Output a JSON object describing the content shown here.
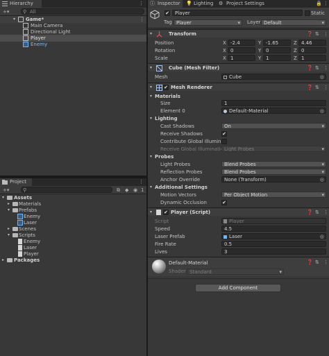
{
  "hierarchy": {
    "tab_label": "Hierarchy",
    "search_placeholder": "All",
    "items": [
      {
        "label": "Game*"
      },
      {
        "label": "Main Camera"
      },
      {
        "label": "Directional Light"
      },
      {
        "label": "Player"
      },
      {
        "label": "Enemy"
      }
    ]
  },
  "project": {
    "tab_label": "Project",
    "badge_count": "1",
    "tree": [
      {
        "label": "Assets"
      },
      {
        "label": "Materials"
      },
      {
        "label": "Prefabs"
      },
      {
        "label": "Enemy"
      },
      {
        "label": "Laser"
      },
      {
        "label": "Scenes"
      },
      {
        "label": "Scripts"
      },
      {
        "label": "Enemy"
      },
      {
        "label": "Laser"
      },
      {
        "label": "Player"
      },
      {
        "label": "Packages"
      }
    ]
  },
  "inspector": {
    "tabs": [
      {
        "label": "Inspector"
      },
      {
        "label": "Lighting"
      },
      {
        "label": "Project Settings"
      }
    ],
    "object": {
      "name": "Player",
      "static_label": "Static",
      "tag_label": "Tag",
      "tag_value": "Player",
      "layer_label": "Layer",
      "layer_value": "Default"
    },
    "transform": {
      "title": "Transform",
      "rows": [
        {
          "label": "Position",
          "x": "-2.4",
          "y": "-1.65",
          "z": "4.46"
        },
        {
          "label": "Rotation",
          "x": "0",
          "y": "0",
          "z": "0"
        },
        {
          "label": "Scale",
          "x": "1",
          "y": "1",
          "z": "1"
        }
      ],
      "axis_x": "X",
      "axis_y": "Y",
      "axis_z": "Z"
    },
    "mesh_filter": {
      "title": "Cube (Mesh Filter)",
      "mesh_label": "Mesh",
      "mesh_value": "Cube"
    },
    "mesh_renderer": {
      "title": "Mesh Renderer",
      "materials_label": "Materials",
      "size_label": "Size",
      "size_value": "1",
      "element_label": "Element 0",
      "element_value": "Default-Material",
      "lighting_label": "Lighting",
      "cast_shadows_label": "Cast Shadows",
      "cast_shadows_value": "On",
      "receive_shadows_label": "Receive Shadows",
      "contribute_gi_label": "Contribute Global Illumination",
      "receive_gi_label": "Receive Global Illumination",
      "receive_gi_value": "Light Probes",
      "probes_label": "Probes",
      "light_probes_label": "Light Probes",
      "light_probes_value": "Blend Probes",
      "reflection_probes_label": "Reflection Probes",
      "reflection_probes_value": "Blend Probes",
      "anchor_override_label": "Anchor Override",
      "anchor_override_value": "None (Transform)",
      "additional_label": "Additional Settings",
      "motion_vectors_label": "Motion Vectors",
      "motion_vectors_value": "Per Object Motion",
      "dynamic_occlusion_label": "Dynamic Occlusion"
    },
    "player_script": {
      "title": "Player (Script)",
      "script_label": "Script",
      "script_value": "Player",
      "speed_label": "Speed",
      "speed_value": "4.5",
      "laser_prefab_label": "Laser Prefab",
      "laser_prefab_value": "Laser",
      "fire_rate_label": "Fire Rate",
      "fire_rate_value": "0.5",
      "lives_label": "Lives",
      "lives_value": "3"
    },
    "material": {
      "name": "Default-Material",
      "shader_label": "Shader",
      "shader_value": "Standard"
    },
    "add_component_label": "Add Component"
  }
}
